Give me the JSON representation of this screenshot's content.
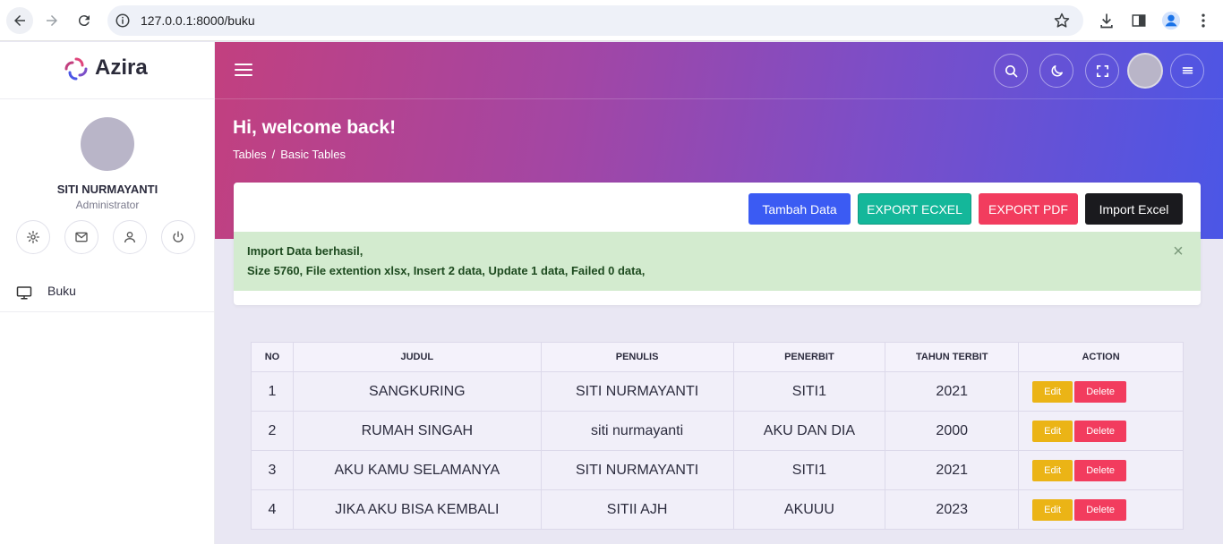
{
  "browser": {
    "url": "127.0.0.1:8000/buku"
  },
  "sidebar": {
    "brand": "Azira",
    "profile": {
      "name": "SITI NURMAYANTI",
      "role": "Administrator"
    },
    "menu": [
      {
        "label": "Buku",
        "icon": "monitor-icon"
      }
    ]
  },
  "header": {
    "title": "Hi, welcome back!",
    "breadcrumb": [
      "Tables",
      "Basic Tables"
    ],
    "breadcrumb_sep": "/"
  },
  "toolbar": {
    "add_label": "Tambah Data",
    "export_excel_label": "EXPORT ECXEL",
    "export_pdf_label": "EXPORT PDF",
    "import_label": "Import Excel"
  },
  "alert": {
    "line1": "Import Data berhasil,",
    "line2": "Size 5760, File extention xlsx, Insert 2 data, Update 1 data, Failed 0 data,",
    "close": "×"
  },
  "table": {
    "columns": [
      "NO",
      "JUDUL",
      "PENULIS",
      "PENERBIT",
      "TAHUN TERBIT",
      "ACTION"
    ],
    "rows": [
      {
        "no": "1",
        "judul": "SANGKURING",
        "penulis": "SITI NURMAYANTI",
        "penerbit": "SITI1",
        "tahun": "2021"
      },
      {
        "no": "2",
        "judul": "RUMAH SINGAH",
        "penulis": "siti nurmayanti",
        "penerbit": "AKU DAN DIA",
        "tahun": "2000"
      },
      {
        "no": "3",
        "judul": "AKU KAMU SELAMANYA",
        "penulis": "SITI NURMAYANTI",
        "penerbit": "SITI1",
        "tahun": "2021"
      },
      {
        "no": "4",
        "judul": "JIKA AKU BISA KEMBALI",
        "penulis": "SITII AJH",
        "penerbit": "AKUUU",
        "tahun": "2023"
      }
    ],
    "edit_label": "Edit",
    "delete_label": "Delete"
  },
  "colors": {
    "primary": "#3b5bf3",
    "success": "#14b79a",
    "danger": "#f23c5e",
    "warning": "#ebb416",
    "dark": "#1a1a1e",
    "alert_bg": "#d3ebcf"
  }
}
